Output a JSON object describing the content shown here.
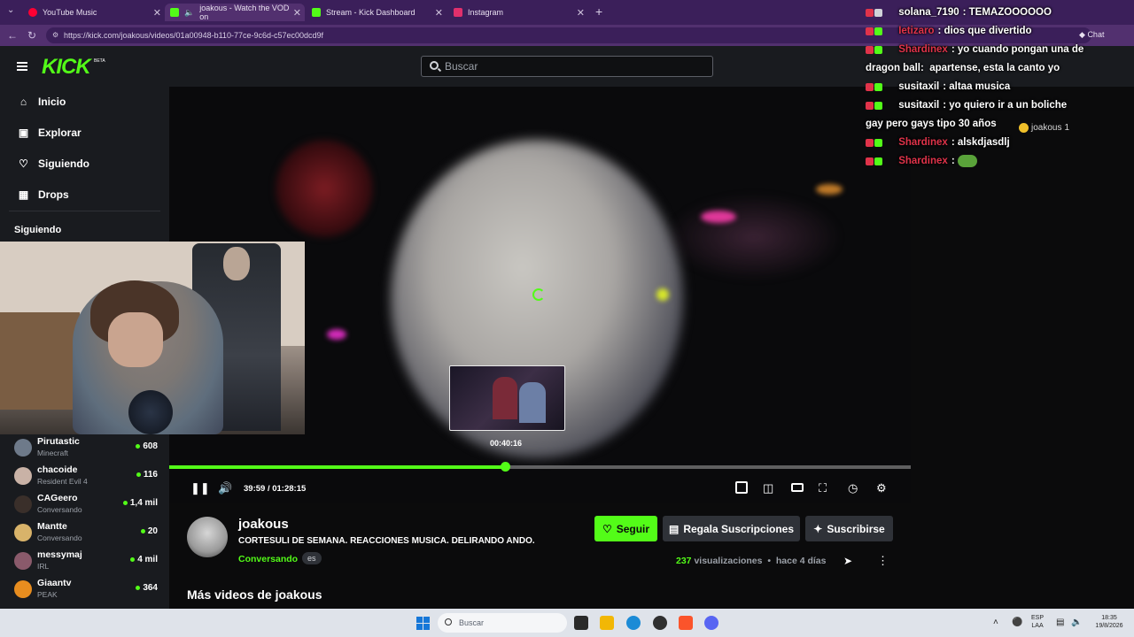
{
  "browser": {
    "tabs": [
      {
        "label": "YouTube Music",
        "color": "#ff0033"
      },
      {
        "label": "joakous - Watch the VOD on",
        "color": "#53fc18"
      },
      {
        "label": "Stream - Kick Dashboard",
        "color": "#53fc18"
      },
      {
        "label": "Instagram",
        "color": "#e1306c"
      }
    ],
    "url": "https://kick.com/joakous/videos/01a00948-b110-77ce-9c6d-c57ec00dcd9f"
  },
  "header": {
    "logo": "KICK",
    "logo_badge": "BETA",
    "search_placeholder": "Buscar"
  },
  "sidebar": {
    "nav": [
      {
        "label": "Inicio",
        "icon": "home-icon"
      },
      {
        "label": "Explorar",
        "icon": "compass-icon"
      },
      {
        "label": "Siguiendo",
        "icon": "heart-icon"
      },
      {
        "label": "Drops",
        "icon": "drops-icon"
      }
    ],
    "following_title": "Siguiendo",
    "following": [
      {
        "name": "Pirutastic",
        "category": "Minecraft",
        "viewers": "608",
        "avatar": "#6e7a8a"
      },
      {
        "name": "chacoide",
        "category": "Resident Evil 4",
        "viewers": "116",
        "avatar": "#c9b2a6"
      },
      {
        "name": "CAGeero",
        "category": "Conversando",
        "viewers": "1,4 mil",
        "avatar": "#3a2f2a"
      },
      {
        "name": "Mantte",
        "category": "Conversando",
        "viewers": "20",
        "avatar": "#d8b36a"
      },
      {
        "name": "messymaj",
        "category": "IRL",
        "viewers": "4 mil",
        "avatar": "#8a5a6b"
      },
      {
        "name": "Giaantv",
        "category": "PEAK",
        "viewers": "364",
        "avatar": "#e88d1f"
      }
    ]
  },
  "player": {
    "preview_time": "00:40:16",
    "current_time": "39:59",
    "total_time": "01:28:15",
    "progress_fraction": 0.453,
    "accent": "#53fc18"
  },
  "chat": {
    "messages": [
      {
        "user": "solana_7190",
        "user_color": "#ffffff",
        "text": "TEMAZOOOOOO"
      },
      {
        "user": "Ietizaro",
        "user_color": "#e0334a",
        "text": "dios que divertido"
      },
      {
        "user": "Shardinex",
        "user_color": "#e0334a",
        "text": "yo cuando pongan una de"
      },
      {
        "user": "",
        "user_color": "#ffffff",
        "text": "dragon ball:  apartense, esta la canto yo"
      },
      {
        "user": "susitaxil",
        "user_color": "#ffffff",
        "text": "altaa musica"
      },
      {
        "user": "susitaxil",
        "user_color": "#ffffff",
        "text": "yo quiero ir a un boliche"
      },
      {
        "user": "",
        "user_color": "#ffffff",
        "text": "gay pero gays tipo 30 años"
      },
      {
        "user": "Shardinex",
        "user_color": "#e0334a",
        "text": "alskdjasdlj"
      },
      {
        "user": "Shardinex",
        "user_color": "#e0334a",
        "text": ""
      }
    ],
    "pill_user": "joakous",
    "pill_count": "1",
    "chat_button": "Chat"
  },
  "channel": {
    "name": "joakous",
    "title": "CORTESULI DE SEMANA. REACCIONES MUSICA. DELIRANDO ANDO.",
    "category": "Conversando",
    "language": "es",
    "follow_label": "Seguir",
    "gift_label": "Regala Suscripciones",
    "subscribe_label": "Suscribirse",
    "views_count": "237",
    "views_label": "visualizaciones",
    "time_ago": "hace 4 días",
    "more_videos": "Más videos de joakous"
  },
  "taskbar": {
    "search_placeholder": "Buscar",
    "lang_top": "ESP",
    "lang_bottom": "LAA",
    "time": "18:35",
    "date": "19/8/2026"
  }
}
